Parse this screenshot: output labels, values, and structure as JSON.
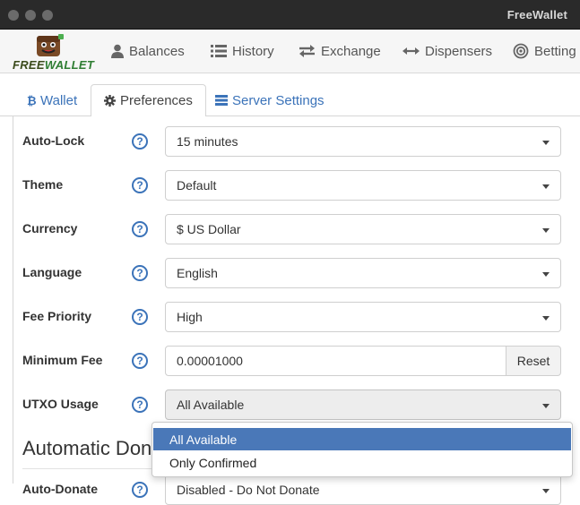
{
  "window": {
    "title": "FreeWallet"
  },
  "logo": {
    "text_free": "FREE",
    "text_wallet": "WALLET"
  },
  "nav": [
    {
      "label": "Balances",
      "icon": "user-icon"
    },
    {
      "label": "History",
      "icon": "list-icon"
    },
    {
      "label": "Exchange",
      "icon": "exchange-icon"
    },
    {
      "label": "Dispensers",
      "icon": "arrows-h-icon"
    },
    {
      "label": "Betting",
      "icon": "target-icon"
    }
  ],
  "tabs": [
    {
      "label": "Wallet",
      "icon": "bitcoin-icon",
      "active": false
    },
    {
      "label": "Preferences",
      "icon": "gear-icon",
      "active": true
    },
    {
      "label": "Server Settings",
      "icon": "server-icon",
      "active": false
    }
  ],
  "preferences": {
    "auto_lock": {
      "label": "Auto-Lock",
      "value": "15 minutes"
    },
    "theme": {
      "label": "Theme",
      "value": "Default"
    },
    "currency": {
      "label": "Currency",
      "value": "$ US Dollar"
    },
    "language": {
      "label": "Language",
      "value": "English"
    },
    "fee_priority": {
      "label": "Fee Priority",
      "value": "High"
    },
    "minimum_fee": {
      "label": "Minimum Fee",
      "value": "0.00001000",
      "button": "Reset"
    },
    "utxo_usage": {
      "label": "UTXO Usage",
      "value": "All Available",
      "options": [
        "All Available",
        "Only Confirmed"
      ],
      "selected_index": 0
    }
  },
  "auto_donate": {
    "section_title": "Automatic Dona",
    "label": "Auto-Donate",
    "value": "Disabled - Do Not Donate"
  },
  "help_glyph": "?",
  "colors": {
    "accent": "#3b73b9",
    "selected": "#4a78b8",
    "titlebar": "#2a2a2a"
  }
}
